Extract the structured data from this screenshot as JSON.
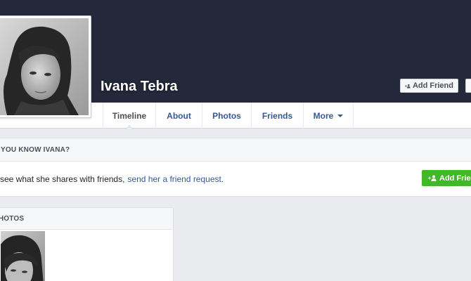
{
  "profile": {
    "name": "Ivana Tebra"
  },
  "cover_actions": {
    "add_friend_label": "Add Friend"
  },
  "nav": {
    "tabs": [
      {
        "label": "Timeline"
      },
      {
        "label": "About"
      },
      {
        "label": "Photos"
      },
      {
        "label": "Friends"
      },
      {
        "label": "More"
      }
    ]
  },
  "know_card": {
    "header": "YOU KNOW IVANA?",
    "body_text": "see what she shares with friends,",
    "link_text": "send her a friend request.",
    "button_label": "Add Friend"
  },
  "photos_card": {
    "header": "PHOTOS"
  },
  "colors": {
    "cover": "#23293a",
    "link": "#365899",
    "green_button": "#42b72a",
    "page_bg": "#e9ebee"
  },
  "icons": {
    "add_friend": "add-friend-icon",
    "more_caret": "chevron-down-icon"
  }
}
